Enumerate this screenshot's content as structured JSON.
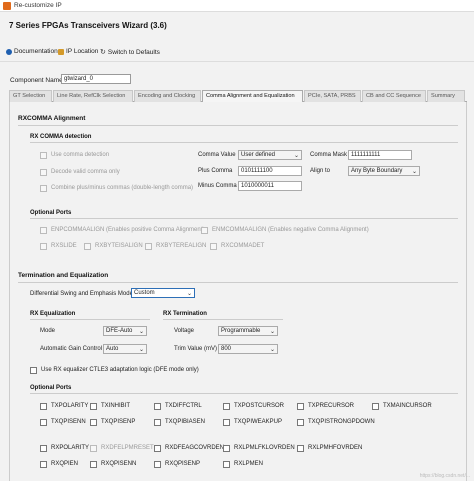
{
  "window": {
    "title": "Re-customize IP"
  },
  "wizard": {
    "title": "7 Series FPGAs Transceivers Wizard (3.6)"
  },
  "toolbar": {
    "documentation": "Documentation",
    "ip_location": "IP Location",
    "switch_defaults": "Switch to Defaults"
  },
  "component": {
    "label": "Component Name",
    "value": "gtwizard_0"
  },
  "tabs": [
    "GT Selection",
    "Line Rate, RefClk Selection",
    "Encoding and Clocking",
    "Comma Alignment and Equalization",
    "PCIe, SATA, PRBS",
    "CB and CC Sequence",
    "Summary"
  ],
  "rxcomma": {
    "section": "RXCOMMA Alignment",
    "detection": "RX COMMA detection",
    "use_comma": "Use comma detection",
    "decode_only": "Decode valid comma only",
    "combine": "Combine plus/minus commas (double-length comma)",
    "comma_value_label": "Comma Value",
    "comma_value": "User defined",
    "plus_comma_label": "Plus Comma",
    "plus_comma": "0101111100",
    "minus_comma_label": "Minus Comma",
    "minus_comma": "1010000011",
    "comma_mask_label": "Comma Mask",
    "comma_mask": "1111111111",
    "align_to_label": "Align to",
    "align_to": "Any Byte Boundary"
  },
  "optional_ports1": {
    "title": "Optional Ports",
    "items": [
      "ENPCOMMAALIGN (Enables positive Comma Alignment)",
      "ENMCOMMAALIGN (Enables negative Comma Alignment)",
      "RXSLIDE",
      "RXBYTEISALIGN",
      "RXBYTEREALIGN",
      "RXCOMMADET"
    ]
  },
  "termination": {
    "section": "Termination and Equalization",
    "swing_label": "Differential Swing and Emphasis Mode",
    "swing": "Custom",
    "rx_eq": "RX Equalization",
    "mode_label": "Mode",
    "mode": "DFE-Auto",
    "agc_label": "Automatic Gain Control",
    "agc": "Auto",
    "rx_term": "RX Termination",
    "voltage_label": "Voltage",
    "voltage": "Programmable",
    "trim_label": "Trim Value (mV)",
    "trim": "800",
    "ctle3": "Use RX equalizer CTLE3 adaptation logic (DFE mode only)"
  },
  "optional_ports2": {
    "title": "Optional Ports",
    "items": [
      "TXPOLARITY",
      "TXINHIBIT",
      "TXDIFFCTRL",
      "TXPOSTCURSOR",
      "TXPRECURSOR",
      "TXMAINCURSOR",
      "TXQPISENN",
      "TXQPISENP",
      "TXQPIBIASEN",
      "TXQPIWEAKPUP",
      "TXQPISTRONGPDOWN",
      "RXPOLARITY",
      "RXDFELPMRESET",
      "RXDFEAGCOVRDEN",
      "RXLPMLFKLOVRDEN",
      "RXLPMHFOVRDEN",
      "RXQPIEN",
      "RXQPISENN",
      "RXQPISENP",
      "RXLPMEN"
    ]
  },
  "watermark": "https://blog.csdn.net/..."
}
